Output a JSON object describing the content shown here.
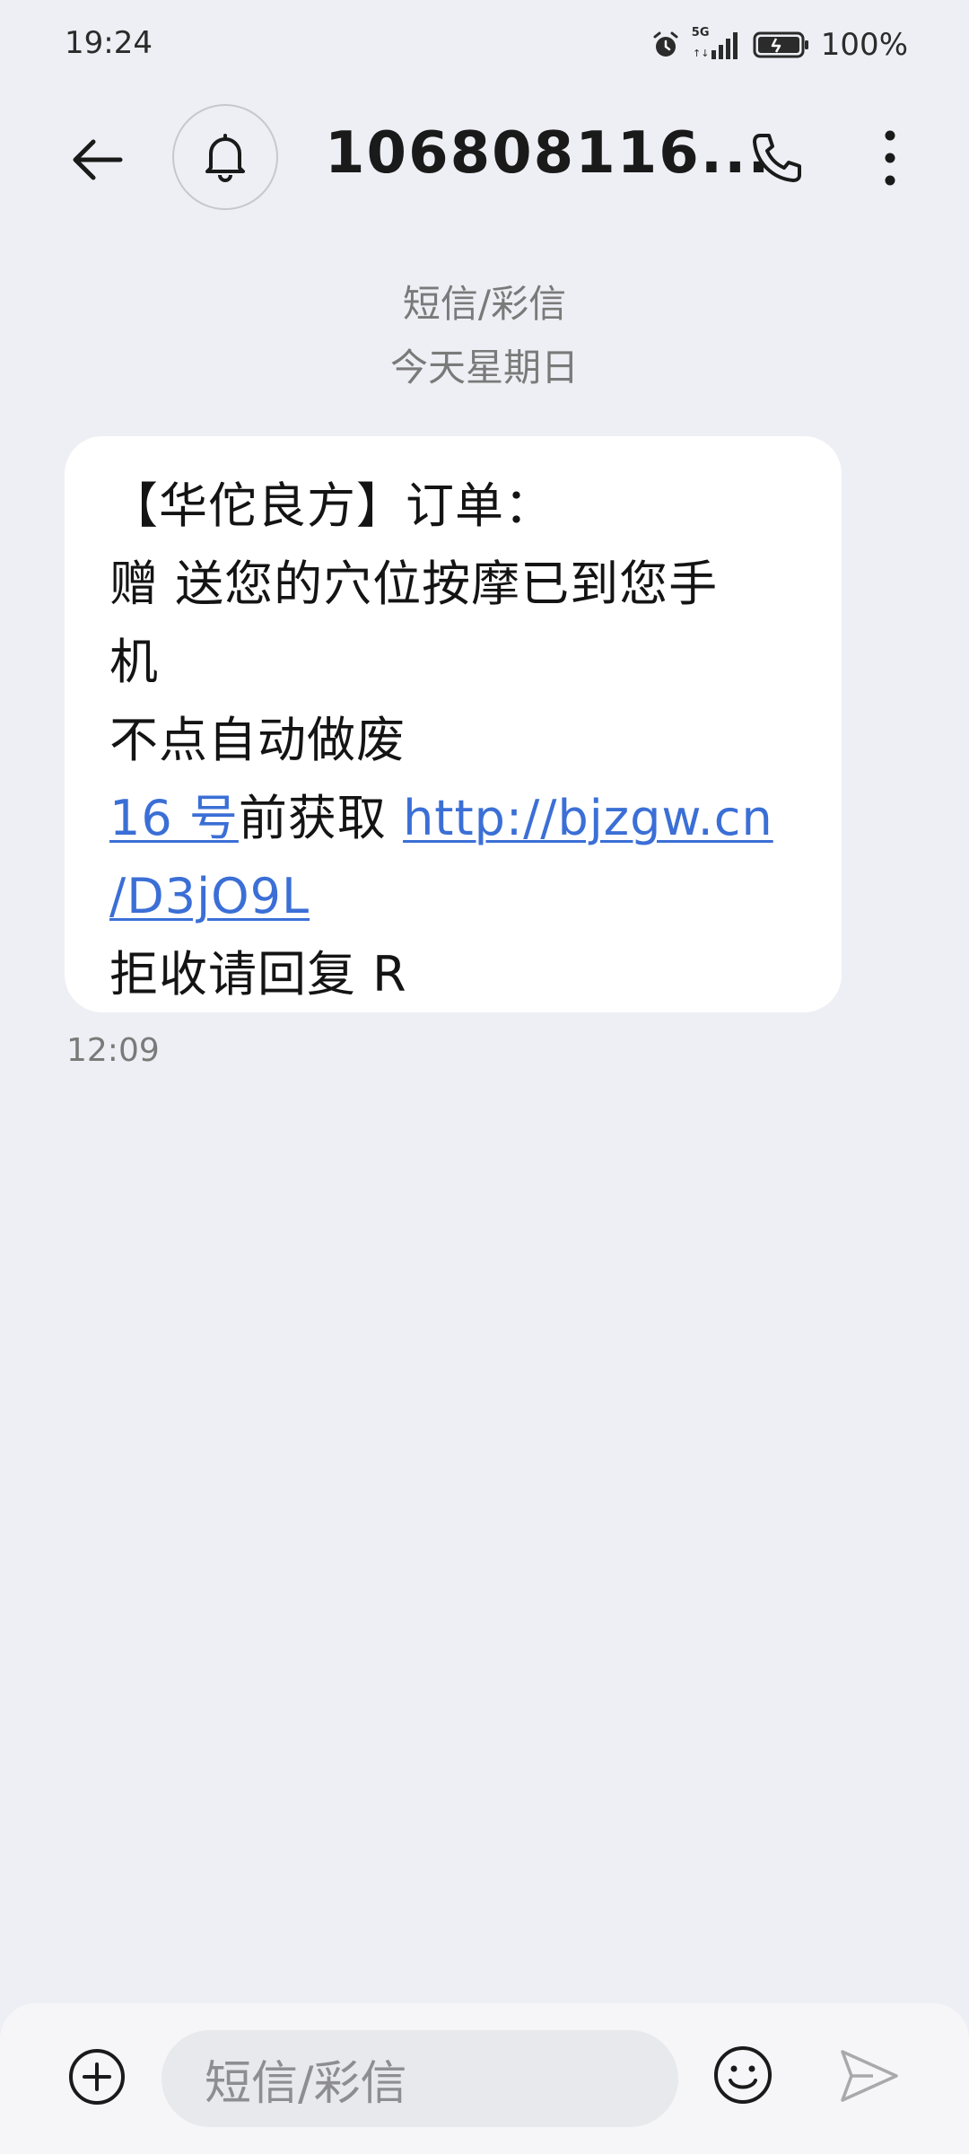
{
  "status_bar": {
    "time": "19:24",
    "network": "5G",
    "battery": "100%"
  },
  "header": {
    "contact": "106808116...",
    "icons": [
      "back-arrow-icon",
      "bell-icon",
      "phone-icon",
      "more-vertical-icon"
    ]
  },
  "thread": {
    "type": "短信/彩信",
    "date": "今天星期日"
  },
  "message": {
    "line1": "【华佗良方】订单：",
    "line2": "赠 送您的穴位按摩已到您手",
    "line3": "机",
    "line4": "不点自动做废",
    "line5_date_link": "16 号",
    "line5_text": "前获取 ",
    "line5_url_part1": "http://bjzgw.cn",
    "line6_url_part2": "/D3jO9L",
    "line7": "拒收请回复 R",
    "time": "12:09"
  },
  "composer": {
    "placeholder": "短信/彩信",
    "icons": [
      "add-icon",
      "emoji-icon",
      "send-icon"
    ]
  },
  "colors": {
    "background": "#eeeff4",
    "bubble": "#ffffff",
    "link": "#3b6fd6"
  }
}
